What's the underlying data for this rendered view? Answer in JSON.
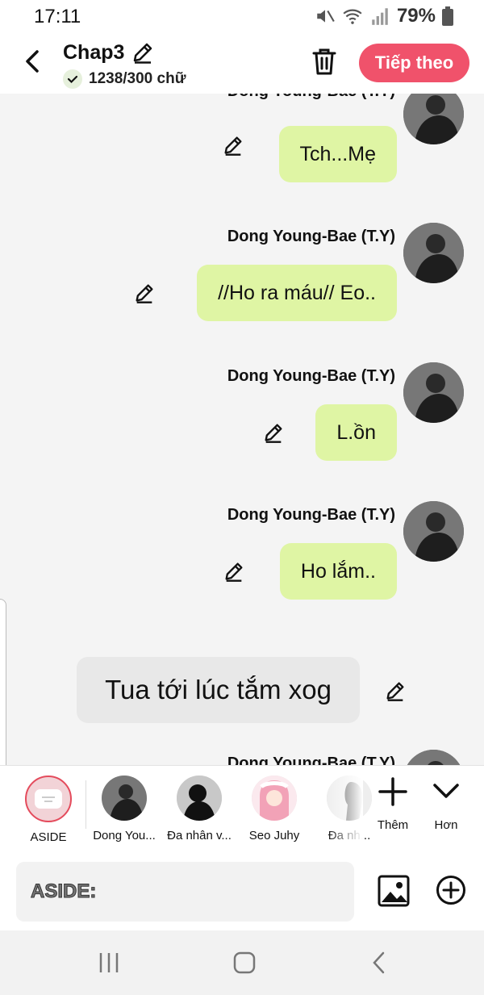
{
  "status_bar": {
    "time": "17:11",
    "battery": "79%"
  },
  "header": {
    "title": "Chap3",
    "word_count": "1238/300 chữ",
    "next_label": "Tiếp theo"
  },
  "messages": [
    {
      "sender": "Dong Young-Bae (T.Y)",
      "text": "Tch...Mẹ"
    },
    {
      "sender": "Dong Young-Bae (T.Y)",
      "text": "//Ho ra máu// Eo.."
    },
    {
      "sender": "Dong Young-Bae (T.Y)",
      "text": "L.ồn"
    },
    {
      "sender": "Dong Young-Bae (T.Y)",
      "text": "Ho lắm.."
    },
    {
      "aside": "Tua tới lúc tắm xog"
    },
    {
      "sender": "Dong Young-Bae (T.Y)",
      "text": ""
    }
  ],
  "characters": [
    {
      "name": "ASIDE",
      "selected": true
    },
    {
      "name": "Dong You..."
    },
    {
      "name": "Đa nhân v..."
    },
    {
      "name": "Seo Juhy"
    },
    {
      "name": "Đa nh..."
    }
  ],
  "tools": {
    "add_label": "Thêm",
    "more_label": "Hơn"
  },
  "input": {
    "placeholder": "ASIDE:"
  },
  "colors": {
    "accent": "#f0526b",
    "bubble": "#dff5a4",
    "aside_bubble": "#e8e8e8"
  }
}
